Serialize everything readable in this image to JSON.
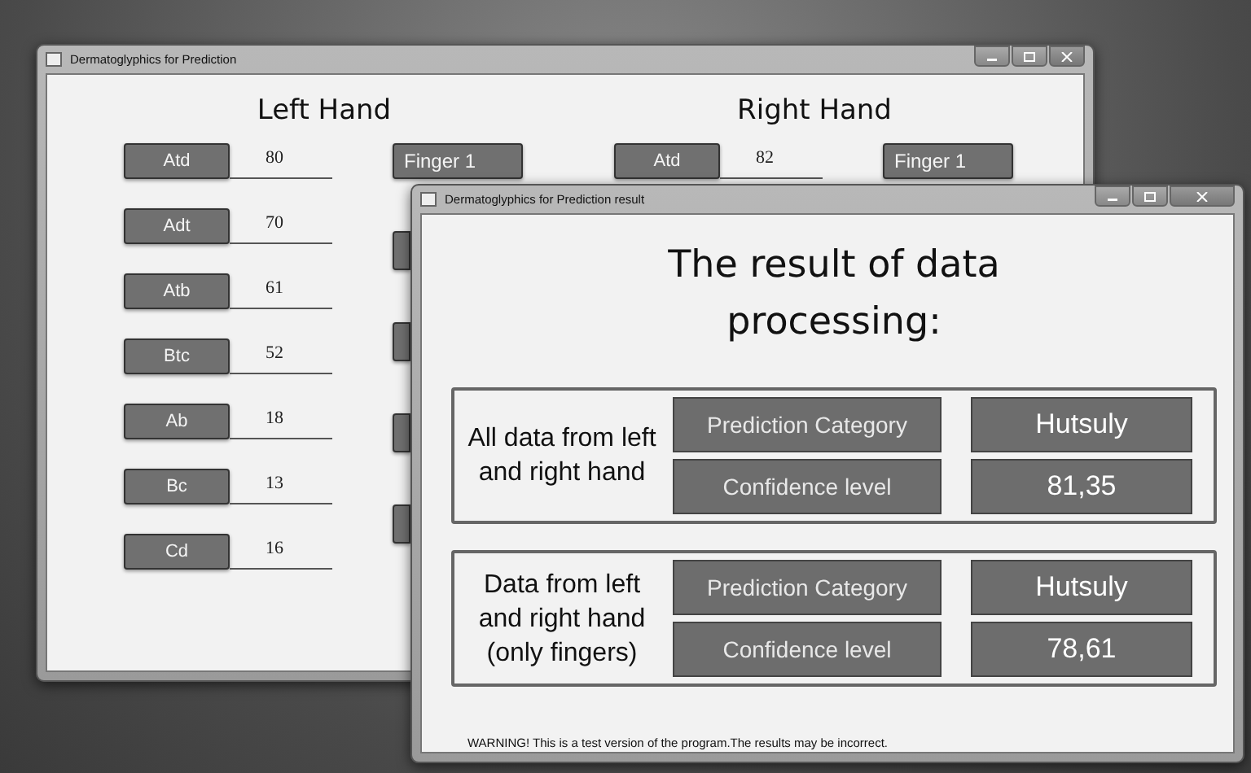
{
  "main_window": {
    "title": "Dermatoglyphics for Prediction",
    "hands": [
      {
        "heading": "Left Hand",
        "finger_button": "Finger 1",
        "measures": [
          {
            "label": "Atd",
            "value": "80"
          },
          {
            "label": "Adt",
            "value": "70"
          },
          {
            "label": "Atb",
            "value": "61"
          },
          {
            "label": "Btc",
            "value": "52"
          },
          {
            "label": "Ab",
            "value": "18"
          },
          {
            "label": "Bc",
            "value": "13"
          },
          {
            "label": "Cd",
            "value": "16"
          }
        ]
      },
      {
        "heading": "Right Hand",
        "finger_button": "Finger 1",
        "measures": [
          {
            "label": "Atd",
            "value": "82"
          }
        ]
      }
    ]
  },
  "result_window": {
    "title": "Dermatoglyphics for Prediction result",
    "heading": "The result of data processing:",
    "groups": [
      {
        "description": "All data from left and right hand",
        "rows": [
          {
            "label": "Prediction Category",
            "value": "Hutsuly"
          },
          {
            "label": "Confidence level",
            "value": "81,35"
          }
        ]
      },
      {
        "description": "Data from left and right hand (only fingers)",
        "rows": [
          {
            "label": "Prediction Category",
            "value": "Hutsuly"
          },
          {
            "label": "Confidence level",
            "value": "78,61"
          }
        ]
      }
    ],
    "warning": "WARNING! This is a test version of the program.The results may be incorrect."
  }
}
